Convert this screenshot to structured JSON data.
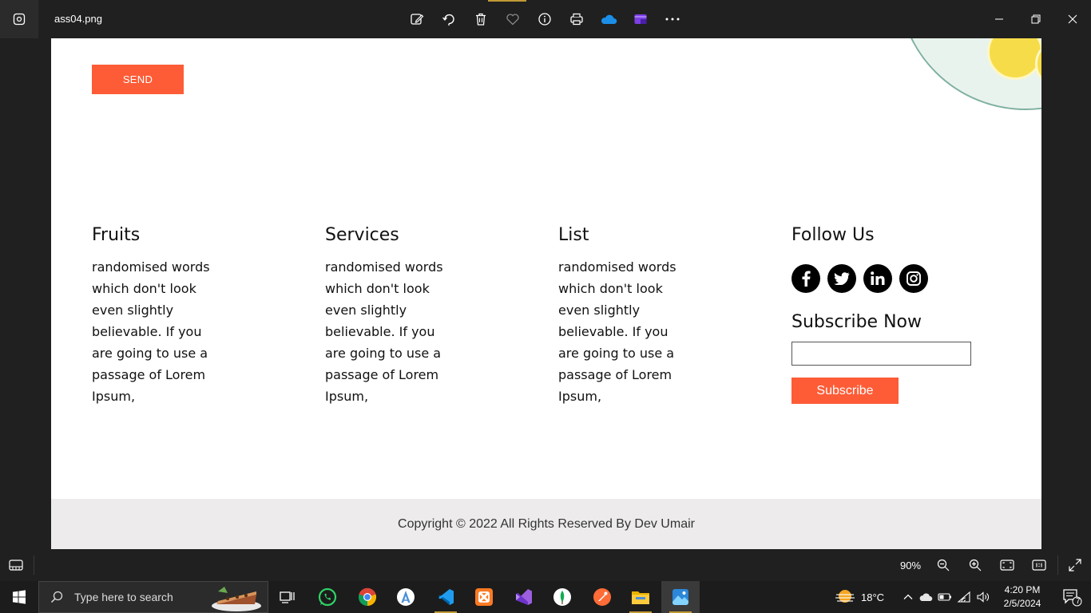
{
  "window": {
    "file_name": "ass04.png",
    "toolbar_icons": [
      "edit-icon",
      "rotate-icon",
      "delete-icon",
      "favorite-icon",
      "info-icon",
      "print-icon",
      "onedrive-icon",
      "clipchamp-icon",
      "more-icon"
    ],
    "controls": [
      "minimize-icon",
      "restore-icon",
      "close-icon"
    ]
  },
  "page": {
    "send_label": "SEND",
    "columns": [
      {
        "title": "Fruits",
        "text": "randomised words which don't look even slightly believable. If you are going to use a passage of Lorem Ipsum,"
      },
      {
        "title": "Services",
        "text": "randomised words which don't look even slightly believable. If you are going to use a passage of Lorem Ipsum,"
      },
      {
        "title": "List",
        "text": "randomised words which don't look even slightly believable. If you are going to use a passage of Lorem Ipsum,"
      }
    ],
    "follow": {
      "title": "Follow Us",
      "socials": [
        "facebook-icon",
        "twitter-icon",
        "linkedin-icon",
        "instagram-icon"
      ],
      "subscribe_title": "Subscribe Now",
      "subscribe_input_value": "",
      "subscribe_label": "Subscribe"
    },
    "copyright": "Copyright © 2022 All Rights Reserved By Dev Umair",
    "colors": {
      "accent": "#fd5c37",
      "footer_bg": "#edebec"
    }
  },
  "statusbar": {
    "zoom": "90%"
  },
  "taskbar": {
    "search_placeholder": "Type here to search",
    "weather": "18°C",
    "time": "4:20 PM",
    "date": "2/5/2024",
    "notifications": "7"
  }
}
